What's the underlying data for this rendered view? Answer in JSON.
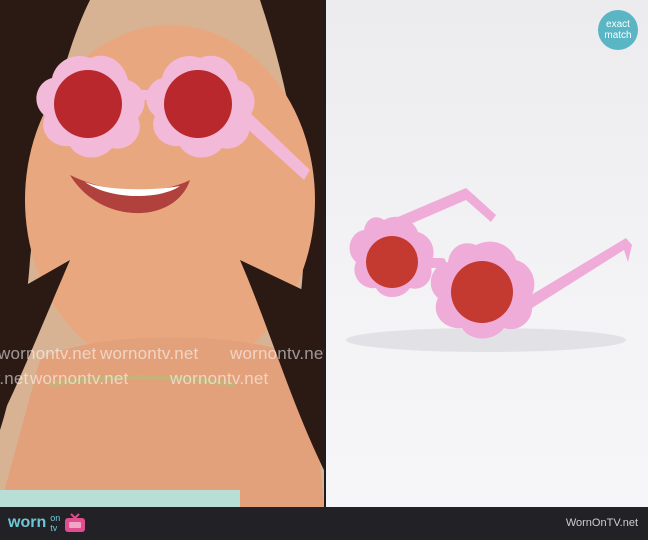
{
  "badge": {
    "line1": "exact",
    "line2": "match"
  },
  "watermark": "wornontv.net",
  "footer": {
    "logo_word": "worn",
    "logo_on": "on",
    "logo_tv": "tv",
    "site": "WornOnTV.net"
  },
  "colors": {
    "frame_pink": "#f2b9d8",
    "lens_red": "#b8282c",
    "badge": "#5ab5c4",
    "footer_bg": "#222226"
  },
  "icons": [
    "tv-icon"
  ]
}
